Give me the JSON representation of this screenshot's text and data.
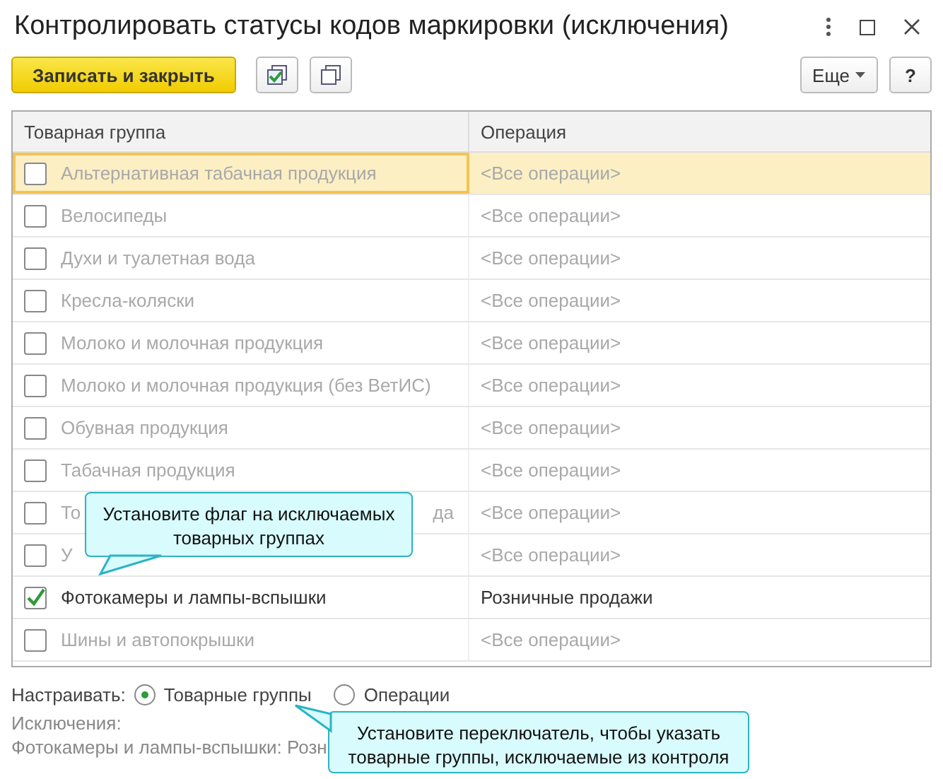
{
  "window": {
    "title": "Контролировать статусы кодов маркировки (исключения)"
  },
  "toolbar": {
    "save_button": "Записать и закрыть",
    "more_button": "Еще",
    "help_button": "?"
  },
  "table": {
    "columns": [
      "Товарная группа",
      "Операция"
    ],
    "rows": [
      {
        "name": "Альтернативная табачная продукция",
        "operation": "<Все операции>",
        "checked": false,
        "selected": true
      },
      {
        "name": "Велосипеды",
        "operation": "<Все операции>",
        "checked": false,
        "selected": false
      },
      {
        "name": "Духи и туалетная вода",
        "operation": "<Все операции>",
        "checked": false,
        "selected": false
      },
      {
        "name": "Кресла-коляски",
        "operation": "<Все операции>",
        "checked": false,
        "selected": false
      },
      {
        "name": "Молоко и молочная продукция",
        "operation": "<Все операции>",
        "checked": false,
        "selected": false
      },
      {
        "name": "Молоко и молочная продукция (без ВетИС)",
        "operation": "<Все операции>",
        "checked": false,
        "selected": false
      },
      {
        "name": "Обувная продукция",
        "operation": "<Все операции>",
        "checked": false,
        "selected": false
      },
      {
        "name": "Табачная продукция",
        "operation": "<Все операции>",
        "checked": false,
        "selected": false
      },
      {
        "name": "То",
        "name_tail": "да",
        "operation": "<Все операции>",
        "checked": false,
        "selected": false
      },
      {
        "name": "У",
        "operation": "<Все операции>",
        "checked": false,
        "selected": false
      },
      {
        "name": "Фотокамеры и лампы-вспышки",
        "operation": "Розничные продажи",
        "checked": true,
        "selected": false
      },
      {
        "name": "Шины и автопокрышки",
        "operation": "<Все операции>",
        "checked": false,
        "selected": false
      }
    ]
  },
  "settings": {
    "label": "Настраивать:",
    "options": [
      {
        "label": "Товарные группы",
        "selected": true
      },
      {
        "label": "Операции",
        "selected": false
      }
    ]
  },
  "exceptions": {
    "label": "Исключения:",
    "text": "Фотокамеры и лампы-вспышки: Розн"
  },
  "callouts": [
    {
      "text": "Установите флаг на исключаемых товарных группах",
      "kind": "down-left"
    },
    {
      "text": "Установите переключатель, чтобы указать товарные группы, исключаемые из контроля",
      "kind": "left"
    }
  ]
}
